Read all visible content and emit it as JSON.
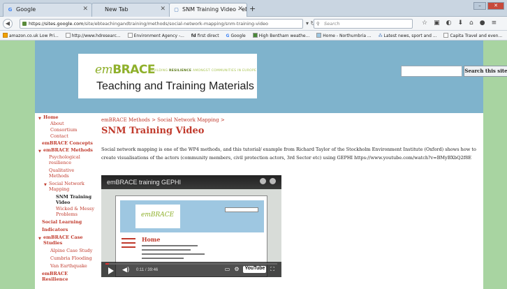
{
  "browser": {
    "tabs": [
      {
        "label": "Google",
        "icon": "G"
      },
      {
        "label": "New Tab",
        "icon": ""
      },
      {
        "label": "SNM Training Video - eB T...",
        "icon": "▢"
      }
    ],
    "new_tab": "+",
    "url_domain": "https://sites.google.com",
    "url_path": "/site/ebteachingandtraining/methods/social-network-mapping/snm-training-video",
    "search_placeholder": "Search",
    "bookmarks": [
      "amazon.co.uk Low Pri...",
      "http://www.hdresearc...",
      "Environment Agency -...",
      "first direct",
      "Google",
      "High Bentham weathe...",
      "Home - Northumbria ...",
      "Latest news, sport and ...",
      "Capita Travel and even..."
    ]
  },
  "site": {
    "logo_em": "em",
    "logo_brace": "BRACE",
    "logo_tagline_a": "BUILDING",
    "logo_tagline_b": "RESILIENCE",
    "logo_tagline_c": "AMONGST COMMUNITIES IN EUROPE",
    "title": "Teaching and Training Materials",
    "search_button": "Search this site"
  },
  "sidebar": {
    "items": [
      {
        "label": "Home",
        "arrow": true
      },
      {
        "label": "About"
      },
      {
        "label": "Consortium"
      },
      {
        "label": "Contact"
      },
      {
        "label": "emBRACE Concepts"
      },
      {
        "label": "emBRACE Methods",
        "arrow": true
      },
      {
        "label": "Psychological"
      },
      {
        "label": "resilience"
      },
      {
        "label": "Qualitative"
      },
      {
        "label": "Methods"
      },
      {
        "label": "Social Network",
        "arrow": true
      },
      {
        "label": "Mapping"
      },
      {
        "label": "SNM Training"
      },
      {
        "label": "Video"
      },
      {
        "label": "Wicked & Messy"
      },
      {
        "label": "Problems"
      },
      {
        "label": "Social Learning"
      },
      {
        "label": "Indicators"
      },
      {
        "label": "emBRACE Case",
        "arrow": true
      },
      {
        "label": "Studies"
      },
      {
        "label": "Alpine Case Study"
      },
      {
        "label": "Cumbria Flooding"
      },
      {
        "label": "Van Earthquake"
      },
      {
        "label": "emBRACE"
      },
      {
        "label": "Resilience"
      }
    ]
  },
  "main": {
    "breadcrumb": "emBRACE Methods > Social Network Mapping >",
    "title": "SNM Training Video",
    "body": "Social network mapping is one of the WP4 methods, and this tutorial/ example from Richard Taylor of the Stockholm Environment Institute (Oxford) shows how to create visualisations of the actors (community members, civil protection actors, 3rd Sector etc) using GEPHI https://www.youtube.com/watch?v=BMyBXbQ2f8E"
  },
  "video": {
    "title": "emBRACE training GEPHI",
    "slide_logo": "emBRACE",
    "slide_home": "Home",
    "time": "0:11 / 39:46",
    "played_fraction": 0.005,
    "youtube_label": "YouTube"
  }
}
